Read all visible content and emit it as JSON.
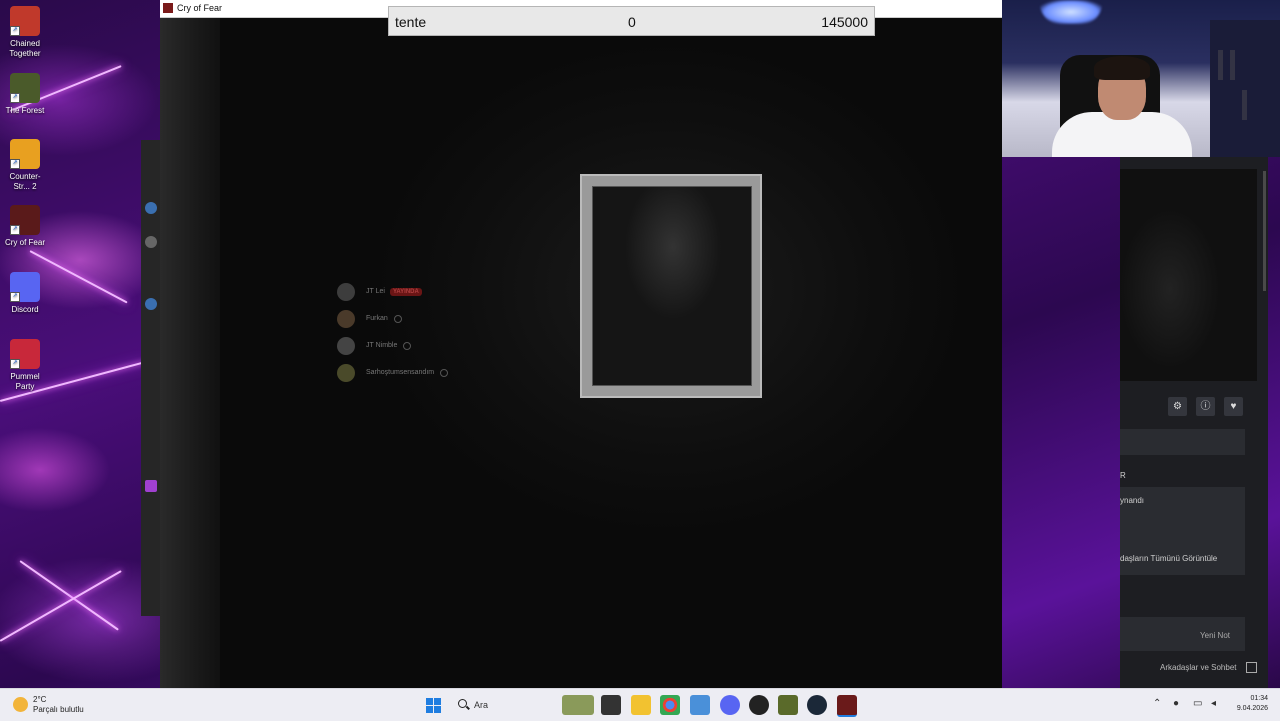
{
  "desktop": {
    "icons": [
      {
        "label": "Chained Together",
        "icon": "chained-together-icon",
        "color": "#c0392b"
      },
      {
        "label": "The Forest",
        "icon": "the-forest-icon",
        "color": "#4a5a2a"
      },
      {
        "label": "Counter-Str... 2",
        "icon": "counter-strike-icon",
        "color": "#e8a020"
      },
      {
        "label": "Cry of Fear",
        "icon": "cry-of-fear-icon",
        "color": "#5a1a1a"
      },
      {
        "label": "Discord",
        "icon": "discord-icon",
        "color": "#5865f2"
      },
      {
        "label": "Pummel Party",
        "icon": "pummel-party-icon",
        "color": "#c8283a"
      }
    ]
  },
  "game_window": {
    "title": "Cry of Fear"
  },
  "score_bar": {
    "name": "tente",
    "current": "0",
    "target": "145000"
  },
  "discord_overlay": {
    "users": [
      {
        "name": "JT Lei",
        "badge": "YAYINDA"
      },
      {
        "name": "Furkan"
      },
      {
        "name": "JT Nimble"
      },
      {
        "name": "Sarhoştumsensandım"
      }
    ]
  },
  "steam_panel": {
    "section_letter": "R",
    "activity_text": "ynandı",
    "view_all_link": "daşların Tümünü Görüntüle",
    "new_note_button": "Yeni Not",
    "friends_chat_button": "Arkadaşlar ve Sohbet"
  },
  "taskbar": {
    "weather_temp": "2°C",
    "weather_desc": "Parçalı bulutlu",
    "search_placeholder": "Ara",
    "time": "01:34",
    "date": "9.04.2026"
  }
}
